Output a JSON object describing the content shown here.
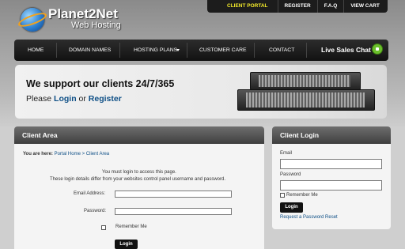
{
  "brand": {
    "name": "Planet2Net",
    "tagline": "Web Hosting"
  },
  "top_menu": [
    "CLIENT PORTAL",
    "REGISTER",
    "F.A.Q",
    "VIEW CART"
  ],
  "nav": {
    "items": [
      "HOME",
      "DOMAIN NAMES",
      "HOSTING PLANS",
      "CUSTOMER CARE",
      "CONTACT"
    ],
    "chat_label": "Live Sales Chat"
  },
  "banner": {
    "headline": "We support our clients 24/7/365",
    "prefix": "Please",
    "login": "Login",
    "or": "or",
    "register": "Register"
  },
  "client_area": {
    "title": "Client Area",
    "you_are_here": "You are here:",
    "breadcrumb_home": "Portal Home",
    "breadcrumb_sep": ">",
    "breadcrumb_current": "Client Area",
    "notice_1": "You must login to access this page.",
    "notice_2": "These login details differ from your websites control panel username and password.",
    "email_label": "Email Address:",
    "password_label": "Password:",
    "remember_label": "Remember Me",
    "login_button": "Login"
  },
  "client_login": {
    "title": "Client Login",
    "email_label": "Email",
    "password_label": "Password",
    "remember_label": "Remember Me",
    "login_button": "Login",
    "reset_link": "Request a Password Reset"
  },
  "colors": {
    "accent_yellow": "#f5ec2a",
    "link_blue": "#0e4f86",
    "nav_dark": "#1c1c1c",
    "chat_green": "#6bbf2b"
  }
}
